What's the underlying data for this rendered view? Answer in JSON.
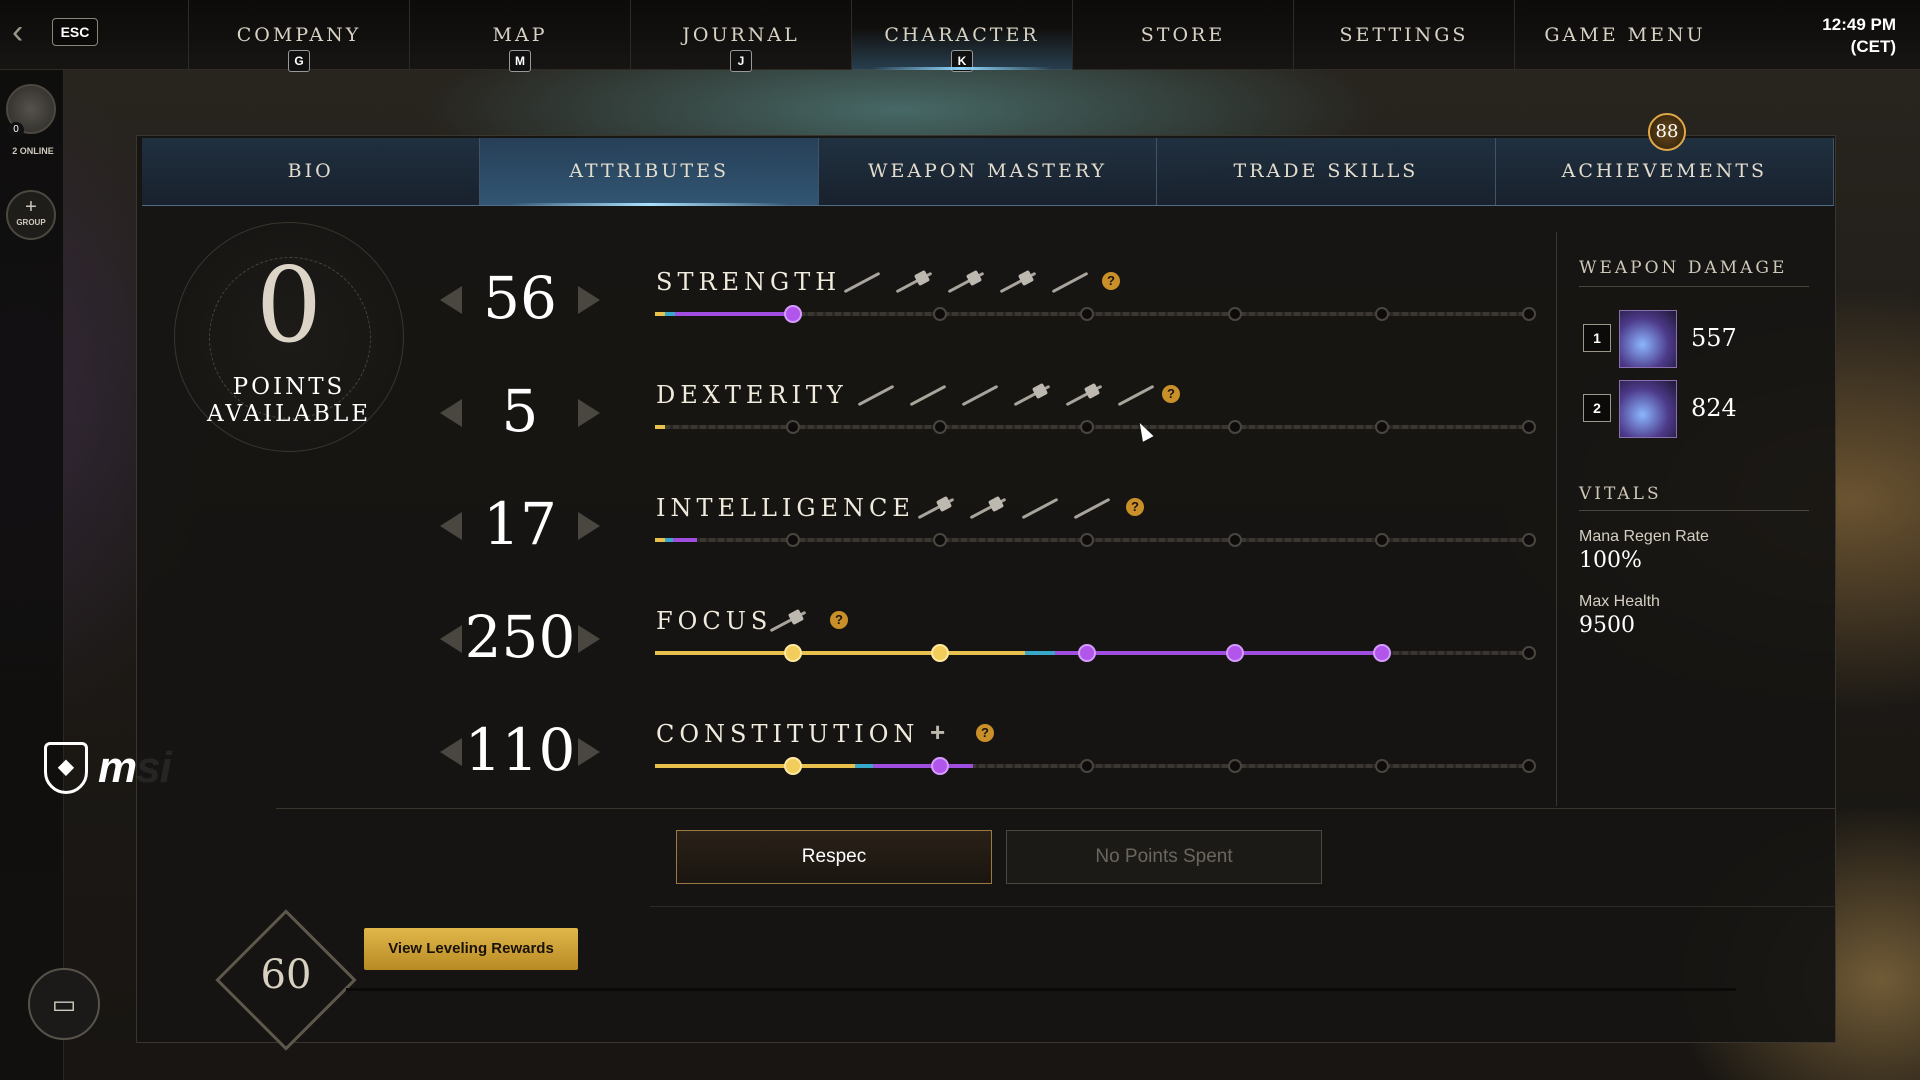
{
  "top_nav": {
    "esc_label": "ESC",
    "items": [
      {
        "label": "COMPANY",
        "key": "G"
      },
      {
        "label": "MAP",
        "key": "M"
      },
      {
        "label": "JOURNAL",
        "key": "J"
      },
      {
        "label": "CHARACTER",
        "key": "K",
        "active": true
      },
      {
        "label": "STORE",
        "key": ""
      },
      {
        "label": "SETTINGS",
        "key": ""
      },
      {
        "label": "GAME MENU",
        "key": ""
      }
    ],
    "clock_time": "12:49 PM",
    "clock_tz": "(CET)"
  },
  "left_rail": {
    "online_count": "0",
    "online_label": "2 ONLINE",
    "group_label": "GROUP"
  },
  "tabs": {
    "items": [
      "BIO",
      "ATTRIBUTES",
      "WEAPON MASTERY",
      "TRADE SKILLS",
      "ACHIEVEMENTS"
    ],
    "active": "ATTRIBUTES",
    "achievement_badge": "88"
  },
  "points": {
    "value": "0",
    "label_line1": "POINTS",
    "label_line2": "AVAILABLE"
  },
  "attributes": [
    {
      "name": "STRENGTH",
      "value": "56",
      "weapon_icon_count": 5
    },
    {
      "name": "DEXTERITY",
      "value": "5",
      "weapon_icon_count": 6
    },
    {
      "name": "INTELLIGENCE",
      "value": "17",
      "weapon_icon_count": 4
    },
    {
      "name": "FOCUS",
      "value": "250",
      "weapon_icon_count": 1
    },
    {
      "name": "CONSTITUTION",
      "value": "110",
      "weapon_icon_count": 0
    }
  ],
  "weapon_damage": {
    "title": "WEAPON DAMAGE",
    "slots": [
      {
        "slot": "1",
        "damage": "557"
      },
      {
        "slot": "2",
        "damage": "824"
      }
    ]
  },
  "vitals": {
    "title": "VITALS",
    "items": [
      {
        "label": "Mana Regen Rate",
        "value": "100%"
      },
      {
        "label": "Max Health",
        "value": "9500"
      }
    ]
  },
  "buttons": {
    "respec": "Respec",
    "no_points": "No Points Spent",
    "view_rewards": "View Leveling Rewards"
  },
  "level": "60",
  "branding": {
    "logo_text": "msi"
  },
  "colors": {
    "gold": "#f2cd5b",
    "purple": "#b255ea",
    "accent_blue": "#8fd6ff"
  }
}
